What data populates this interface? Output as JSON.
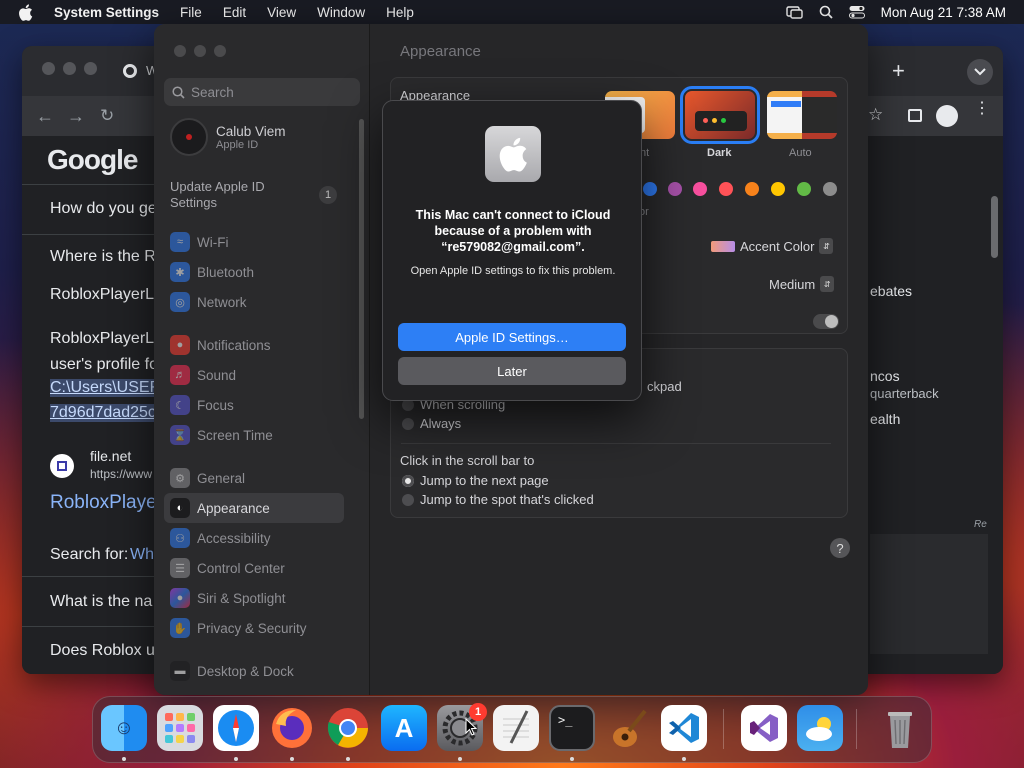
{
  "menubar": {
    "app_name": "System Settings",
    "items": [
      "File",
      "Edit",
      "View",
      "Window",
      "Help"
    ],
    "datetime": "Mon Aug 21  7:38 AM"
  },
  "browser": {
    "tab_title": "W",
    "logo": "Google",
    "lines": [
      "How do you ge",
      "Where is the R",
      "RobloxPlayerLa",
      "RobloxPlayerLa",
      "user's profile fo"
    ],
    "path_lines": [
      "C:\\Users\\USER",
      "7d96d7dad25c"
    ],
    "result_site": "file.net",
    "result_url": "https://www",
    "result_link": "RobloxPlaye",
    "search_for_label": "Search for:",
    "search_for_link": "Wh",
    "lines_bottom": [
      "What is the na",
      "Does Roblox u"
    ],
    "right_texts": [
      "ebates",
      "ncos",
      "quarterback",
      "ealth",
      "Re"
    ]
  },
  "settings": {
    "search_placeholder": "Search",
    "account": {
      "name": "Calub Viem",
      "sub": "Apple ID"
    },
    "update_label": "Update Apple ID Settings",
    "update_count": "1",
    "sidebar_items": [
      {
        "label": "Wi-Fi",
        "icon": "wifi-icon",
        "color": "#2f7cf6"
      },
      {
        "label": "Bluetooth",
        "icon": "bluetooth-icon",
        "color": "#2f7cf6"
      },
      {
        "label": "Network",
        "icon": "globe-icon",
        "color": "#2f7cf6"
      },
      {
        "label": "Notifications",
        "icon": "bell-icon",
        "color": "#ff3b30"
      },
      {
        "label": "Sound",
        "icon": "speaker-icon",
        "color": "#ff2d55"
      },
      {
        "label": "Focus",
        "icon": "moon-icon",
        "color": "#5856d6"
      },
      {
        "label": "Screen Time",
        "icon": "hourglass-icon",
        "color": "#5856d6"
      },
      {
        "label": "General",
        "icon": "gear-icon",
        "color": "#8e8e93"
      },
      {
        "label": "Appearance",
        "icon": "appearance-icon",
        "color": "#1c1c1e"
      },
      {
        "label": "Accessibility",
        "icon": "accessibility-icon",
        "color": "#2f7cf6"
      },
      {
        "label": "Control Center",
        "icon": "control-center-icon",
        "color": "#8e8e93"
      },
      {
        "label": "Siri & Spotlight",
        "icon": "siri-icon",
        "color": "#c643fc"
      },
      {
        "label": "Privacy & Security",
        "icon": "hand-icon",
        "color": "#2f7cf6"
      },
      {
        "label": "Desktop & Dock",
        "icon": "dock-icon",
        "color": "#1c1c1e"
      }
    ],
    "page_title": "Appearance",
    "appearance_label": "Appearance",
    "appearance_options": [
      "nt",
      "Dark",
      "Auto"
    ],
    "accent_fragment": "or",
    "accent_colors": [
      "#2f7cf6",
      "#a550a7",
      "#f74f9e",
      "#ff5257",
      "#f7821b",
      "#ffc600",
      "#62ba46",
      "#8c8c8c"
    ],
    "highlight_color_value": "Accent Color",
    "sidebar_icon_size_value": "Medium",
    "scroll_fragment": "ckpad",
    "scroll_options": [
      "When scrolling",
      "Always"
    ],
    "click_scroll_label": "Click in the scroll bar to",
    "click_options": [
      "Jump to the next page",
      "Jump to the spot that's clicked"
    ],
    "help": "?"
  },
  "dialog": {
    "title": "This Mac can't connect to iCloud because of a problem with “re579082@gmail.com”.",
    "message": "Open Apple ID settings to fix this problem.",
    "primary_button": "Apple ID Settings…",
    "secondary_button": "Later"
  },
  "dock": {
    "badge": "1",
    "apps": [
      "finder-icon",
      "launchpad-icon",
      "safari-icon",
      "firefox-icon",
      "chrome-icon",
      "app-store-icon",
      "system-settings-icon",
      "textedit-icon",
      "terminal-icon",
      "garageband-icon",
      "vscode-icon",
      "visual-studio-icon",
      "weather-icon",
      "trash-icon"
    ]
  }
}
